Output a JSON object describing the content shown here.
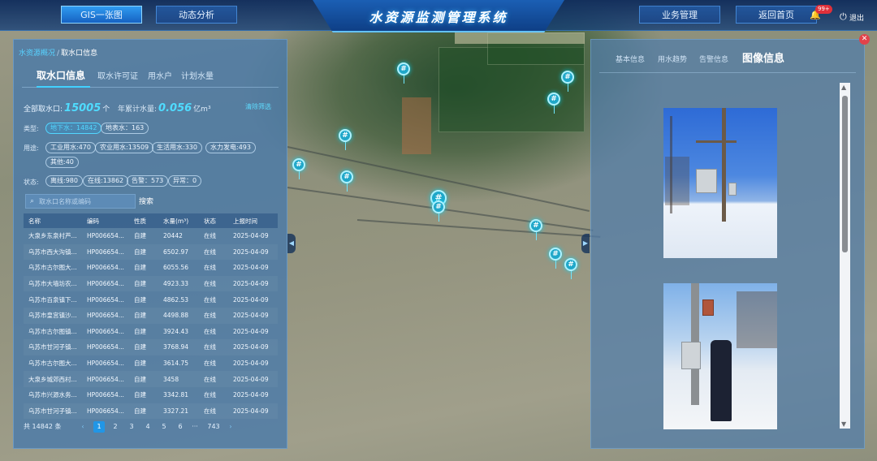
{
  "header": {
    "title": "水资源监测管理系统",
    "nav_left": [
      "GIS一张图",
      "动态分析"
    ],
    "nav_right": [
      "业务管理",
      "返回首页"
    ],
    "badge": "99+",
    "logout": "退出"
  },
  "left": {
    "breadcrumb": [
      "水资源概况",
      "取水口信息"
    ],
    "tabs": [
      "取水口信息",
      "取水许可证",
      "用水户",
      "计划水量"
    ],
    "stats": {
      "total_label": "全部取水口:",
      "total_value": "15005",
      "total_unit": "个",
      "annual_label": "年累计水量:",
      "annual_value": "0.056",
      "annual_unit": "亿m³",
      "clear_filter": "清除筛选"
    },
    "filters": {
      "type_label": "类型:",
      "type": [
        "地下水：14842",
        "地表水：163"
      ],
      "use_label": "用途:",
      "use": [
        "工业用水:470",
        "农业用水:13509",
        "生活用水:330",
        "水力发电:493",
        "其他:40"
      ],
      "status_label": "状态:",
      "status": [
        "离线:980",
        "在线:13862",
        "告警：573",
        "异常：0"
      ]
    },
    "search": {
      "placeholder": "取水口名称或编码",
      "button": "搜索"
    },
    "table": {
      "headers": [
        "名称",
        "编码",
        "性质",
        "水量(m³)",
        "状态",
        "上报时间"
      ],
      "rows": [
        [
          "大泉乡东泉村芦...",
          "HP006654...",
          "自建",
          "20442",
          "在线",
          "2025-04-09"
        ],
        [
          "乌苏市西大沟镇...",
          "HP006654...",
          "自建",
          "6502.97",
          "在线",
          "2025-04-09"
        ],
        [
          "乌苏市古尔图大...",
          "HP006654...",
          "自建",
          "6055.56",
          "在线",
          "2025-04-09"
        ],
        [
          "乌苏市大墙坊农...",
          "HP006654...",
          "自建",
          "4923.33",
          "在线",
          "2025-04-09"
        ],
        [
          "乌苏市百泉镇下...",
          "HP006654...",
          "自建",
          "4862.53",
          "在线",
          "2025-04-09"
        ],
        [
          "乌苏市皇宫镇沙...",
          "HP006654...",
          "自建",
          "4498.88",
          "在线",
          "2025-04-09"
        ],
        [
          "乌苏市古尔图镇...",
          "HP006654...",
          "自建",
          "3924.43",
          "在线",
          "2025-04-09"
        ],
        [
          "乌苏市甘河子镇...",
          "HP006654...",
          "自建",
          "3768.94",
          "在线",
          "2025-04-09"
        ],
        [
          "乌苏市古尔图大...",
          "HP006654...",
          "自建",
          "3614.75",
          "在线",
          "2025-04-09"
        ],
        [
          "大泉乡城郊西村...",
          "HP006654...",
          "自建",
          "3458",
          "在线",
          "2025-04-09"
        ],
        [
          "乌苏市兴源水务...",
          "HP006654...",
          "自建",
          "3342.81",
          "在线",
          "2025-04-09"
        ],
        [
          "乌苏市甘河子镇...",
          "HP006654...",
          "自建",
          "3327.21",
          "在线",
          "2025-04-09"
        ]
      ]
    },
    "pager": {
      "total": "共 14842 条",
      "pages": [
        "1",
        "2",
        "3",
        "4",
        "5",
        "6",
        "···",
        "743"
      ],
      "current": "1",
      "prev": "‹",
      "next": "›"
    }
  },
  "right": {
    "tabs": [
      "基本信息",
      "用水趋势",
      "告警信息",
      "图像信息"
    ],
    "close": "✕"
  },
  "map": {
    "marker_glyph": "#"
  },
  "colors": {
    "accent": "#41d1ff",
    "panel": "#4678aa",
    "header": "#0a285a",
    "alert": "#e0303a"
  }
}
